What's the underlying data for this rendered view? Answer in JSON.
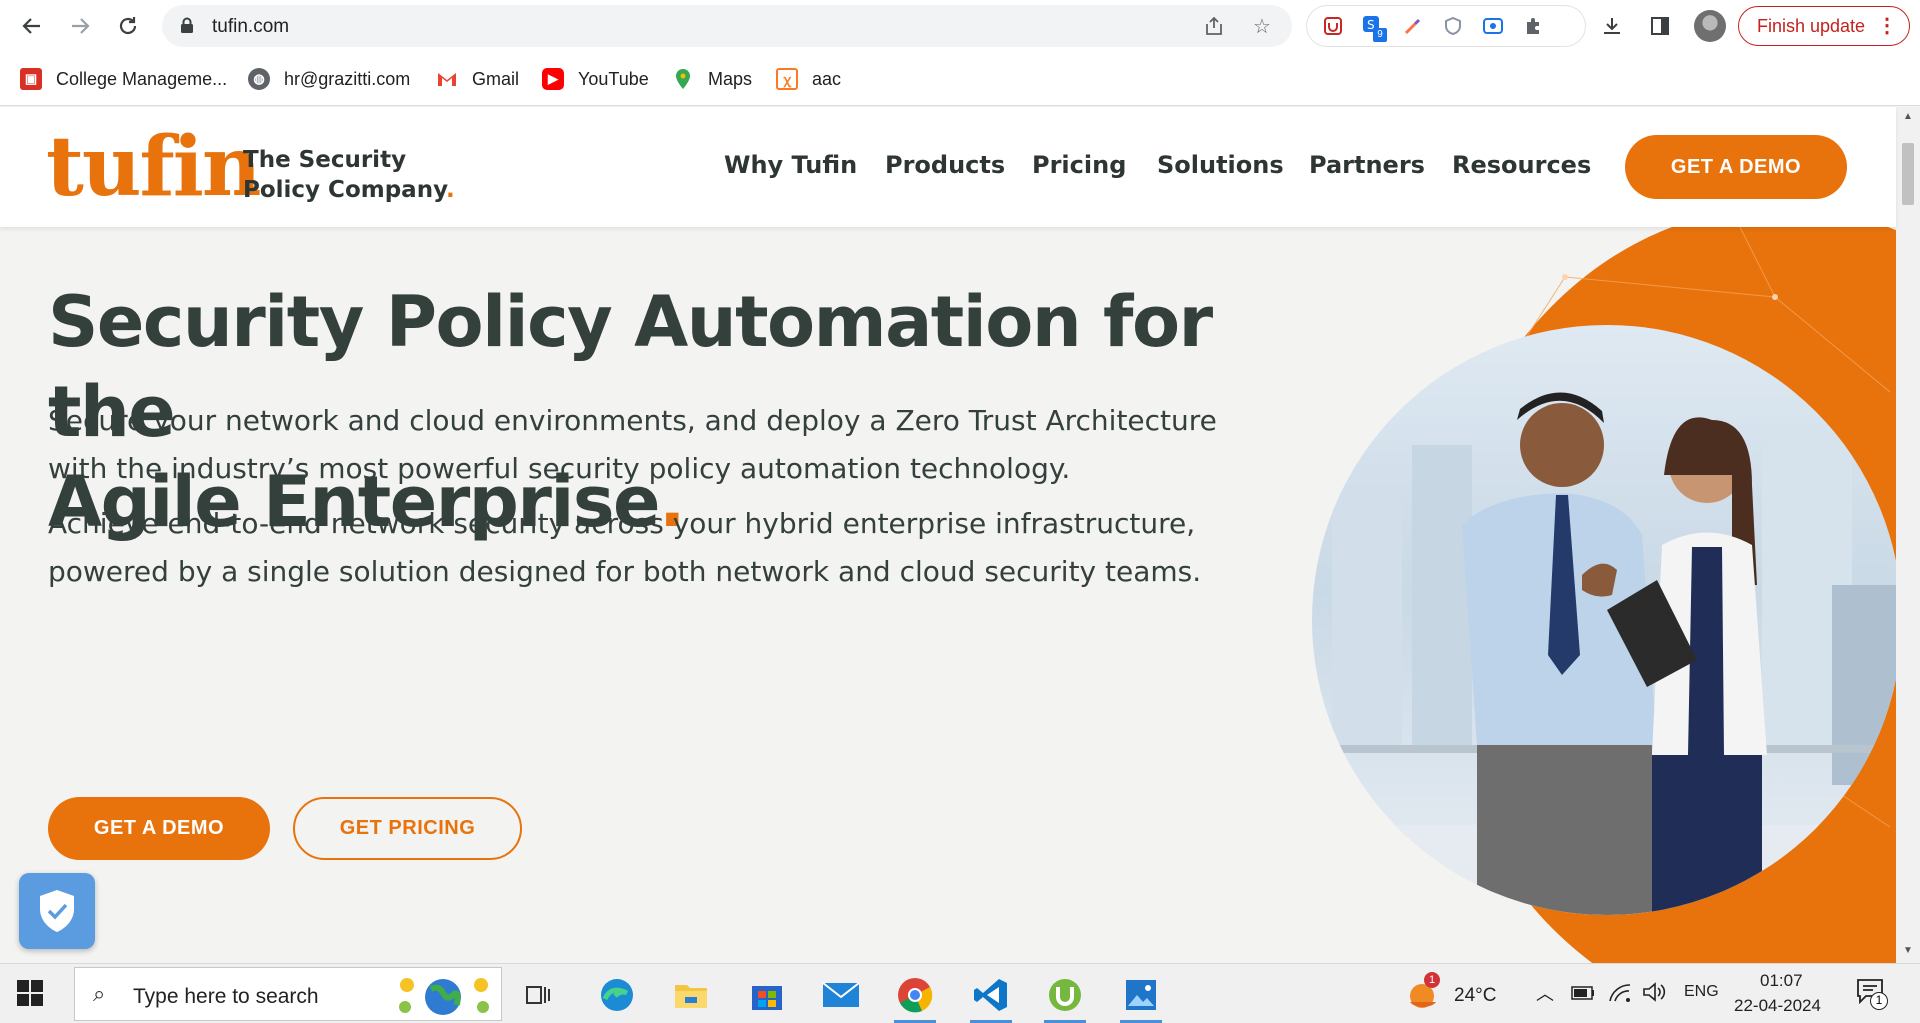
{
  "browser": {
    "url": "tufin.com",
    "finish_update": "Finish update",
    "ext_badge": "9",
    "bookmarks": [
      {
        "label": "College Manageme...",
        "icon": "college-icon",
        "color": "#d93025"
      },
      {
        "label": "hr@grazitti.com",
        "icon": "globe-icon",
        "color": "#5f6368"
      },
      {
        "label": "Gmail",
        "icon": "gmail-icon",
        "color": "#ea4335"
      },
      {
        "label": "YouTube",
        "icon": "youtube-icon",
        "color": "#ff0000"
      },
      {
        "label": "Maps",
        "icon": "maps-icon",
        "color": "#34a853"
      },
      {
        "label": "aac",
        "icon": "xampp-icon",
        "color": "#fb7a24"
      }
    ]
  },
  "site": {
    "logo_word": "tufin",
    "logo_tag_line1": "The Security",
    "logo_tag_line2": "Policy Company",
    "logo_dot": ".",
    "nav": [
      "Why Tufin",
      "Products",
      "Pricing",
      "Solutions",
      "Partners",
      "Resources"
    ],
    "header_cta": "GET A DEMO",
    "accent": "#e8730c",
    "text_color": "#34403c"
  },
  "hero": {
    "title_line1": "Security Policy Automation for the",
    "title_line2": "Agile Enterprise",
    "title_dot": ".",
    "paragraph1": "Secure your network and cloud environments, and deploy a Zero Trust Architecture with the industry’s most powerful security policy automation technology.",
    "paragraph2": "Achieve end-to-end network security across your hybrid enterprise infrastructure, powered by a single solution designed for both network and cloud security teams.",
    "btn_demo": "GET A DEMO",
    "btn_pricing": "GET PRICING"
  },
  "taskbar": {
    "search_placeholder": "Type here to search",
    "weather_temp": "24°C",
    "weather_badge": "1",
    "language": "ENG",
    "time": "01:07",
    "date": "22-04-2024",
    "notification_count": "1"
  }
}
